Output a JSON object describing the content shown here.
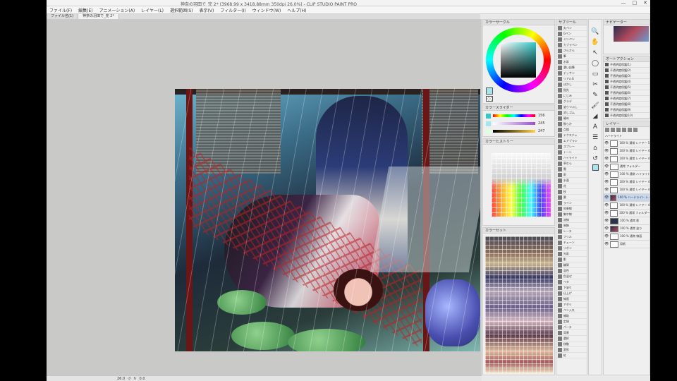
{
  "window": {
    "title": "神奈の羽田で_完 2* (3968.99 x 3418.88mm 350dpi 26.0%) - CLIP STUDIO PAINT PRO",
    "controls": [
      "—",
      "□",
      "✕"
    ]
  },
  "menu": [
    "ファイル(F)",
    "編集(E)",
    "アニメーション(A)",
    "レイヤー(L)",
    "選択範囲(S)",
    "表示(V)",
    "フィルター(I)",
    "ウィンドウ(W)",
    "ヘルプ(H)"
  ],
  "tabs": [
    {
      "label": "ファイル名(1)",
      "active": false
    },
    {
      "label": "神奈の羽田で_完 2*",
      "active": true
    }
  ],
  "status": {
    "zoom": "26.0",
    "position": "0.0"
  },
  "panels": {
    "color_wheel": {
      "title": "カラーサークル"
    },
    "color_slider": {
      "title": "カラースライダー",
      "values": [
        "156",
        "245",
        "247"
      ]
    },
    "color_set": {
      "title": "カラーセット"
    },
    "history": {
      "title": "カラーヒストリー"
    },
    "brush": {
      "title": "サブツール"
    },
    "navigator": {
      "title": "ナビゲーター"
    },
    "auto_action": {
      "title": "オートアクション"
    },
    "layer": {
      "title": "レイヤー",
      "blend_mode": "ハードライト"
    }
  },
  "brush_items": [
    "丸ペン",
    "Gペン",
    "ミリペン",
    "カブラペン",
    "さらさら",
    "筆",
    "水彩",
    "濃い鉛筆",
    "デッサン",
    "リアルG",
    "ぼかし",
    "指先",
    "にじみ",
    "グラデ",
    "塗りつぶし",
    "消しゴム",
    "硬め",
    "軟らか",
    "点描",
    "テクスチャ",
    "エアブラシ",
    "スプレー",
    "トーン",
    "ハイライト",
    "草むら",
    "雲",
    "雨",
    "水面",
    "花",
    "枝",
    "葉",
    "ライン",
    "効果線",
    "集中線",
    "流線",
    "装飾",
    "レース",
    "フリル",
    "チェーン",
    "リボン",
    "光彩",
    "影",
    "輪郭",
    "混色",
    "色混ぜ",
    "ベタ",
    "下塗り",
    "仕上げ",
    "線画",
    "アタリ",
    "ペン入れ",
    "補助",
    "定規",
    "パース",
    "背景",
    "選択",
    "移動",
    "変形",
    "虹"
  ],
  "tools": [
    "🔍",
    "✋",
    "↖",
    "◯",
    "▭",
    "✂",
    "✎",
    "🖌",
    "◢",
    "A",
    "☰",
    "⌂",
    "↺"
  ],
  "auto_actions": [
    "不透明度保護(1)",
    "不透明度保護(2)",
    "不透明度保護(3)",
    "不透明度保護(4)",
    "不透明度保護(5)",
    "不透明度保護(6)",
    "不透明度保護(7)",
    "不透明度保護(8)",
    "不透明度保護(9)",
    "不透明度保護(10)"
  ],
  "layers": [
    {
      "label": "100 % 通常 レイヤー 50",
      "thumb": "plain",
      "sel": false
    },
    {
      "label": "100 % 通常 レイヤー 49",
      "thumb": "plain",
      "sel": false
    },
    {
      "label": "100 % 通常 レイヤー 48",
      "thumb": "plain",
      "sel": false
    },
    {
      "label": "通常 フォルダー",
      "thumb": "plain",
      "sel": false
    },
    {
      "label": "100 % 通常 ハイライト",
      "thumb": "plain",
      "sel": false
    },
    {
      "label": "100 % 通常 レイヤー 47",
      "thumb": "plain",
      "sel": false
    },
    {
      "label": "100 % 通常 レイヤー 46",
      "thumb": "plain",
      "sel": false
    },
    {
      "label": "100 % ハードライト レイヤー 45",
      "thumb": "art",
      "sel": true
    },
    {
      "label": "100 % 通常 レイヤー 44",
      "thumb": "plain",
      "sel": false
    },
    {
      "label": "100 % 通常 フォルダー 2",
      "thumb": "plain",
      "sel": false
    },
    {
      "label": "100 % 通常 影",
      "thumb": "dark",
      "sel": false
    },
    {
      "label": "100 % 通常 塗り",
      "thumb": "art",
      "sel": false
    },
    {
      "label": "100 % 通常 線画",
      "thumb": "plain",
      "sel": false
    },
    {
      "label": "用紙",
      "thumb": "plain",
      "sel": false
    }
  ],
  "colors": {
    "main": "#a4e6f0",
    "canvas_bg": "#c9cac8",
    "accent": "#36c8c8"
  }
}
